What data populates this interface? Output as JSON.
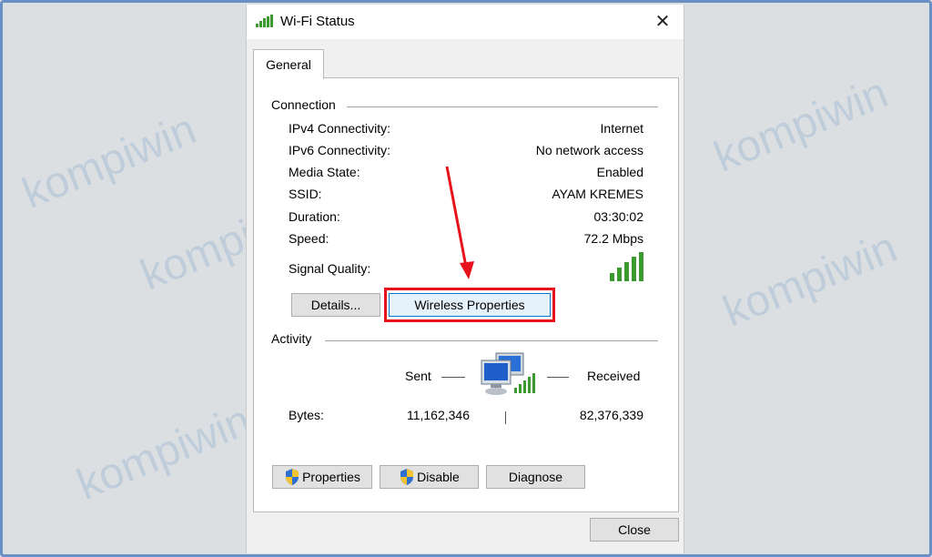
{
  "window": {
    "title": "Wi-Fi Status",
    "close_glyph": "✕"
  },
  "tabs": [
    {
      "label": "General"
    }
  ],
  "connection": {
    "group_label": "Connection",
    "rows": [
      {
        "label": "IPv4 Connectivity:",
        "value": "Internet"
      },
      {
        "label": "IPv6 Connectivity:",
        "value": "No network access"
      },
      {
        "label": "Media State:",
        "value": "Enabled"
      },
      {
        "label": "SSID:",
        "value": "AYAM KREMES"
      },
      {
        "label": "Duration:",
        "value": "03:30:02"
      },
      {
        "label": "Speed:",
        "value": "72.2 Mbps"
      }
    ],
    "signal_quality_label": "Signal Quality:",
    "signal_quality_bars": 5,
    "signal_quality_max": 5,
    "details_button": "Details...",
    "wireless_properties_button": "Wireless Properties"
  },
  "activity": {
    "group_label": "Activity",
    "sent_label": "Sent",
    "received_label": "Received",
    "bytes_label": "Bytes:",
    "bytes_sent": "11,162,346",
    "bytes_received": "82,376,339"
  },
  "actions": {
    "properties_button": "Properties",
    "disable_button": "Disable",
    "diagnose_button": "Diagnose"
  },
  "footer": {
    "close_button": "Close"
  },
  "watermark": {
    "text": "kompiwin"
  },
  "colors": {
    "annotation_red": "#e8121c",
    "signal_green": "#3a9a2e",
    "frame_blue": "#6a8fc4"
  }
}
